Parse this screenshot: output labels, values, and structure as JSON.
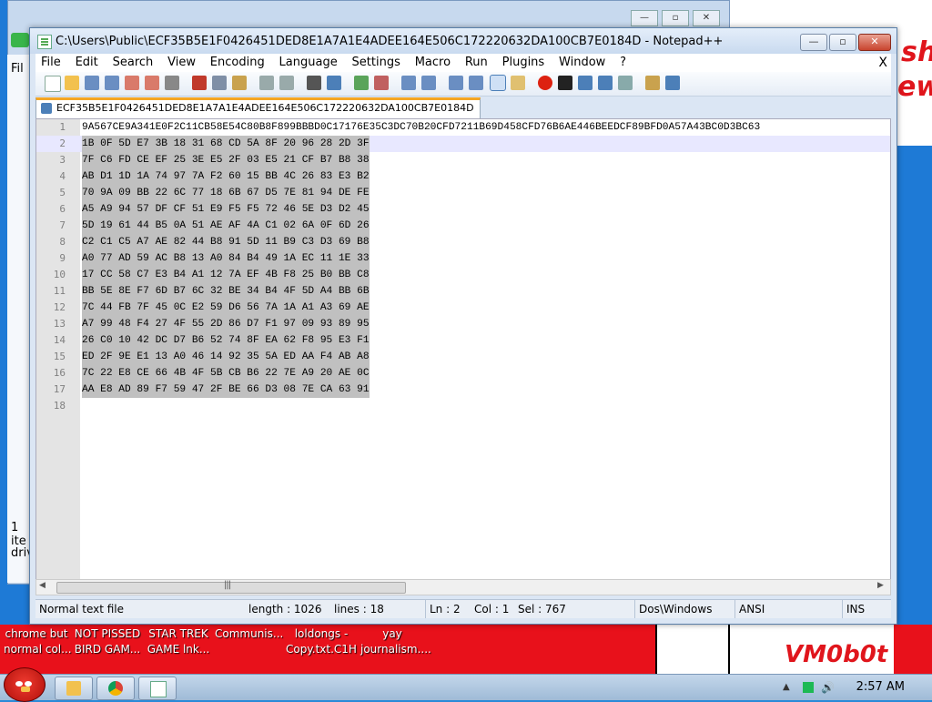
{
  "notepad": {
    "window_title": "C:\\Users\\Public\\ECF35B5E1F0426451DED8E1A7A1E4ADEE164E506C172220632DA100CB7E0184D - Notepad++",
    "menu": [
      "File",
      "Edit",
      "Search",
      "View",
      "Encoding",
      "Language",
      "Settings",
      "Macro",
      "Run",
      "Plugins",
      "Window",
      "?"
    ],
    "menu_close": "X",
    "tab_label": "ECF35B5E1F0426451DED8E1A7A1E4ADEE164E506C172220632DA100CB7E0184D",
    "editor_lines": [
      "9A567CE9A341E0F2C11CB58E54C80B8F899BBBD0C17176E35C3DC70B20CFD7211B69D458CFD76B6AE446BEEDCF89BFD0A57A43BC0D3BC63",
      "1B 0F 5D E7 3B 18 31 68 CD 5A 8F 20 96 28 2D 3F",
      "7F C6 FD CE EF 25 3E E5 2F 03 E5 21 CF B7 B8 38",
      "AB D1 1D 1A 74 97 7A F2 60 15 BB 4C 26 83 E3 B2",
      "70 9A 09 BB 22 6C 77 18 6B 67 D5 7E 81 94 DE FE",
      "A5 A9 94 57 DF CF 51 E9 F5 F5 72 46 5E D3 D2 45",
      "5D 19 61 44 B5 0A 51 AE AF 4A C1 02 6A 0F 6D 26",
      "C2 C1 C5 A7 AE 82 44 B8 91 5D 11 B9 C3 D3 69 B8",
      "A0 77 AD 59 AC B8 13 A0 84 B4 49 1A EC 11 1E 33",
      "17 CC 58 C7 E3 B4 A1 12 7A EF 4B F8 25 B0 BB C8",
      "BB 5E 8E F7 6D B7 6C 32 BE 34 B4 4F 5D A4 BB 6B",
      "7C 44 FB 7F 45 0C E2 59 D6 56 7A 1A A1 A3 69 AE",
      "A7 99 48 F4 27 4F 55 2D 86 D7 F1 97 09 93 89 95",
      "26 C0 10 42 DC D7 B6 52 74 8F EA 62 F8 95 E3 F1",
      "ED 2F 9E E1 13 A0 46 14 92 35 5A ED AA F4 AB A8",
      "7C 22 E8 CE 66 4B 4F 5B CB B6 22 7E A9 20 AE 0C",
      "AA E8 AD 89 F7 59 47 2F BE 66 D3 08 7E CA 63 91",
      ""
    ],
    "status": {
      "type": "Normal text file",
      "length": "length : 1026",
      "lines": "lines : 18",
      "ln": "Ln : 2",
      "col": "Col : 1",
      "sel": "Sel : 767",
      "eol": "Dos\\Windows",
      "encoding": "ANSI",
      "mode": "INS"
    }
  },
  "background_window": {
    "side_texts": [
      "Fil",
      "1 ite",
      "driv"
    ]
  },
  "desktop": {
    "scribble_top": "shi",
    "scribble_top2": "ew",
    "logo": "VM0b0t",
    "items": [
      {
        "line1": "chrome but",
        "line2": "normal col..."
      },
      {
        "line1": "NOT PISSED",
        "line2": "BIRD GAM..."
      },
      {
        "line1": "STAR TREK",
        "line2": "GAME lnk..."
      },
      {
        "line1": "Communis...",
        "line2": ""
      },
      {
        "line1": "loldongs -",
        "line2": "Copy.txt.C1H"
      },
      {
        "line1": "yay",
        "line2": "journalism...."
      }
    ]
  },
  "taskbar": {
    "clock": "2:57 AM"
  },
  "colors": {
    "selection": "#c0c0c0",
    "current_line": "#e8e8ff",
    "tab_accent": "#f5a623",
    "desktop_red": "#e8111b"
  }
}
